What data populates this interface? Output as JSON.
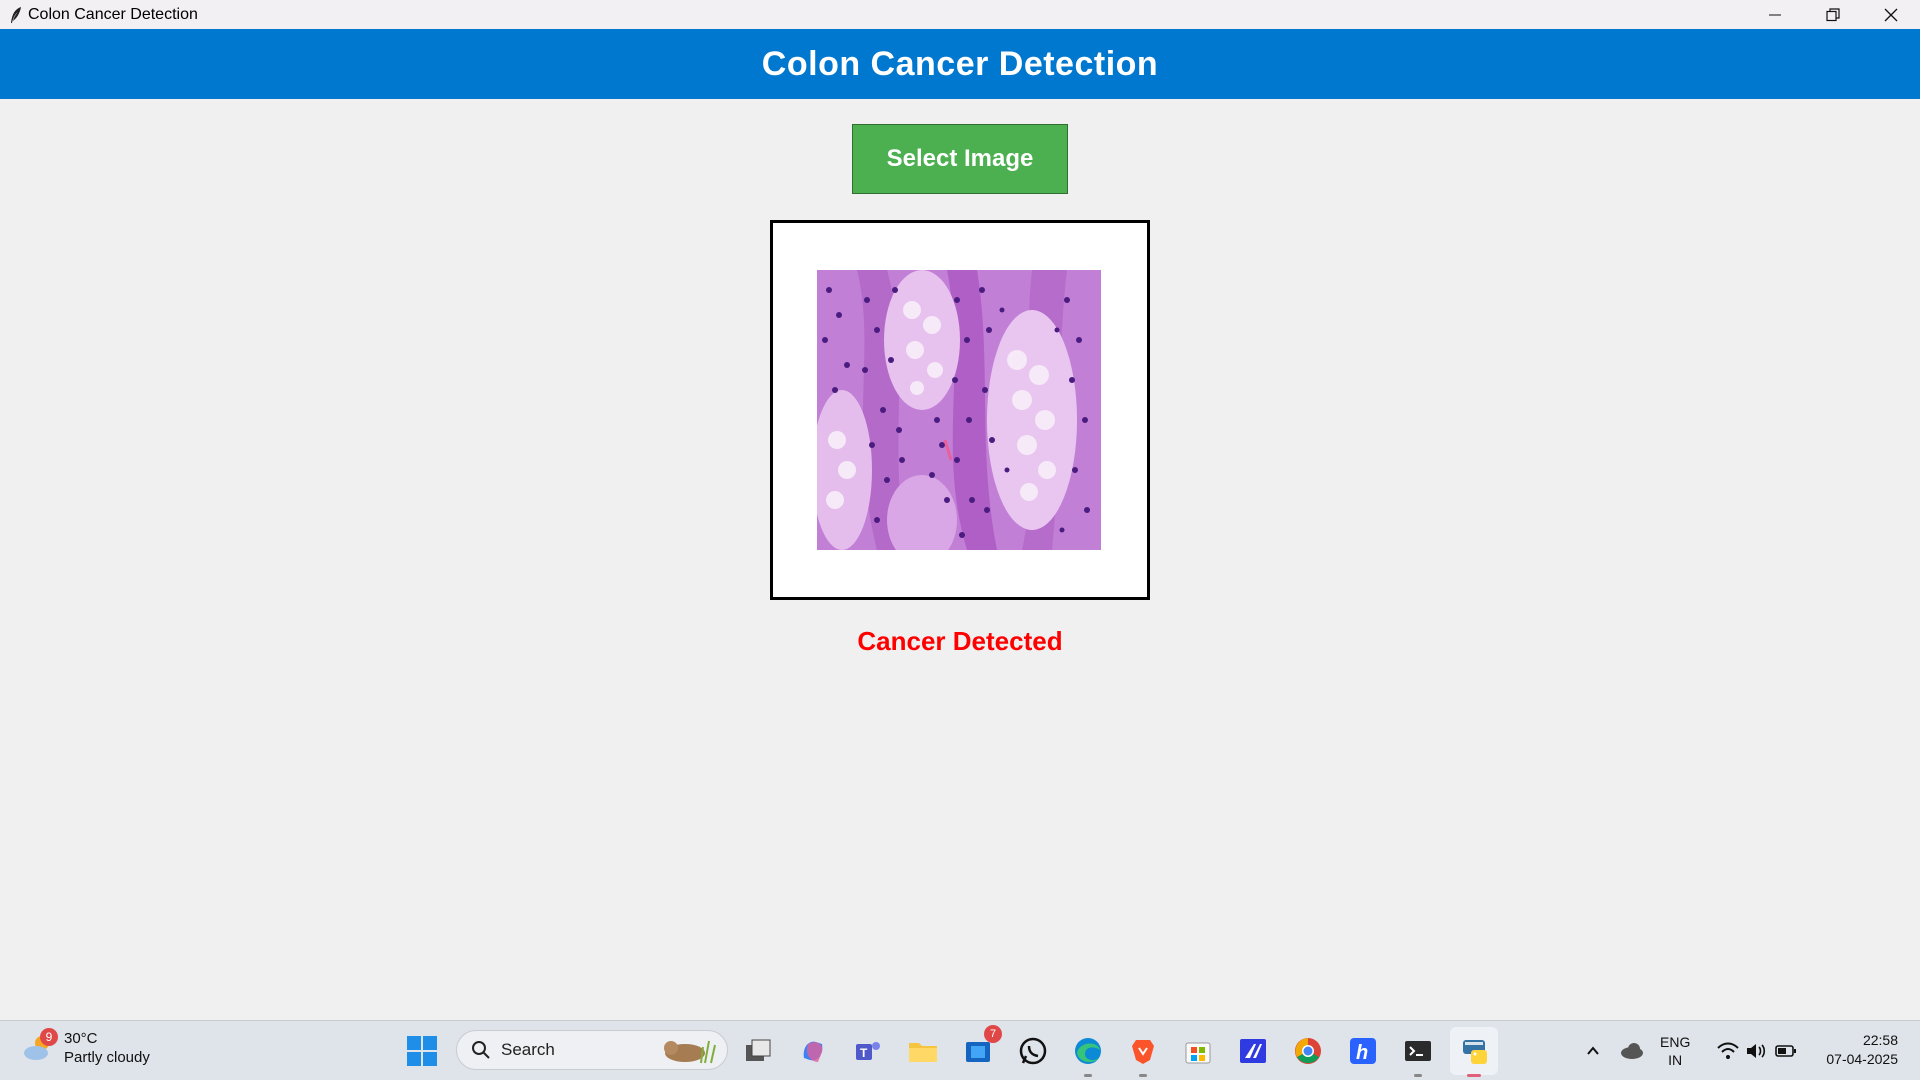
{
  "window": {
    "title": "Colon Cancer Detection",
    "controls": [
      "minimize",
      "restore",
      "close"
    ]
  },
  "header": {
    "title": "Colon Cancer Detection",
    "background": "#0078cf"
  },
  "main": {
    "select_button_label": "Select Image",
    "select_button_color": "#4caf50",
    "result_text": "Cancer Detected",
    "result_color": "#ff0000",
    "image_preview": {
      "content": "H&E stained colon tissue histology image"
    }
  },
  "taskbar": {
    "weather": {
      "temperature": "30°C",
      "condition": "Partly cloudy",
      "badge": "9"
    },
    "search_placeholder": "Search",
    "apps": [
      {
        "name": "task-view-icon"
      },
      {
        "name": "copilot-icon"
      },
      {
        "name": "teams-icon"
      },
      {
        "name": "file-explorer-icon"
      },
      {
        "name": "mail-icon",
        "badge": "7"
      },
      {
        "name": "whatsapp-icon"
      },
      {
        "name": "edge-icon"
      },
      {
        "name": "brave-icon"
      },
      {
        "name": "microsoft-store-icon"
      },
      {
        "name": "editor-icon"
      },
      {
        "name": "chrome-icon"
      },
      {
        "name": "hashnode-icon"
      },
      {
        "name": "terminal-icon"
      },
      {
        "name": "python-icon"
      }
    ],
    "language": {
      "line1": "ENG",
      "line2": "IN"
    },
    "clock": {
      "time": "22:58",
      "date": "07-04-2025"
    }
  }
}
